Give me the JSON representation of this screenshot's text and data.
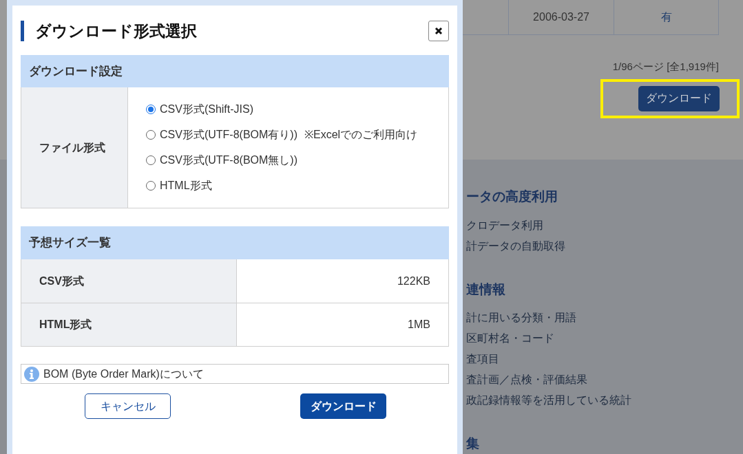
{
  "background": {
    "table_row": [
      "2006-03-27",
      "有"
    ],
    "pagination": "1/96ページ [全1,919件]",
    "download_button": {
      "label": "ダウンロード",
      "highlighted": true
    },
    "sidebar": [
      {
        "heading": "ータの高度利用",
        "links": [
          "クロデータ利用",
          "計データの自動取得"
        ]
      },
      {
        "heading": "連情報",
        "links": [
          "計に用いる分類・用語",
          "区町村名・コード",
          "査項目",
          "査計画／点検・評価結果",
          "政記録情報等を活用している統計"
        ]
      },
      {
        "heading": "集"
      }
    ]
  },
  "dialog": {
    "title": "ダウンロード形式選択",
    "settings": {
      "heading": "ダウンロード設定",
      "label": "ファイル形式",
      "options": [
        {
          "label": "CSV形式(Shift-JIS)",
          "selected": true
        },
        {
          "label": "CSV形式(UTF-8(BOM有り))",
          "note": "※Excelでのご利用向け",
          "selected": false
        },
        {
          "label": "CSV形式(UTF-8(BOM無し))",
          "selected": false
        },
        {
          "label": "HTML形式",
          "selected": false
        }
      ]
    },
    "sizes": {
      "heading": "予想サイズ一覧",
      "rows": [
        {
          "format": "CSV形式",
          "size": "122KB"
        },
        {
          "format": "HTML形式",
          "size": "1MB"
        }
      ]
    },
    "bom_link": "BOM (Byte Order Mark)について",
    "buttons": {
      "cancel": "キャンセル",
      "download": "ダウンロード"
    }
  }
}
